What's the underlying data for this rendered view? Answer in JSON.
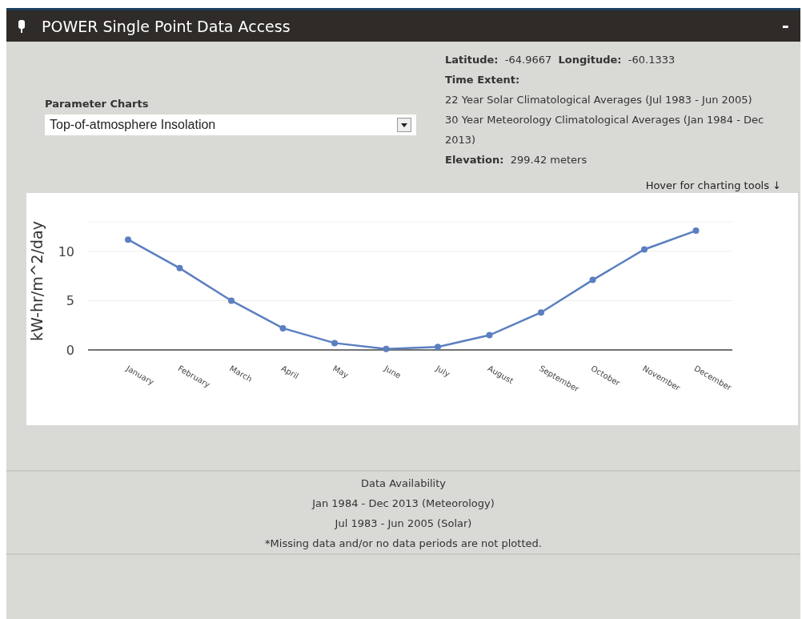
{
  "window": {
    "title": "POWER Single Point Data Access",
    "collapse": "-"
  },
  "parameter": {
    "label": "Parameter Charts",
    "value": "Top-of-atmosphere Insolation"
  },
  "info": [
    {
      "kind": "text",
      "text": "**Latitude:**  -64.9667  **Longitude:**  -60.1333"
    },
    {
      "kind": "label",
      "text": "Time Extent:"
    },
    {
      "kind": "text",
      "text": "22 Year Solar Climatological Averages (Jul 1983 - Jun 2005)"
    },
    {
      "kind": "text",
      "text": "30 Year Meteorology Climatological Averages (Jan 1984 - Dec 2013)"
    },
    {
      "kind": "text",
      "text": "**Elevation:**  299.42 meters"
    }
  ],
  "hover_hint": "Hover for charting tools ↓",
  "chart_data": {
    "type": "line",
    "ylabel": "kW-hr/m^2/day",
    "categories": [
      "January",
      "February",
      "March",
      "April",
      "May",
      "June",
      "July",
      "August",
      "September",
      "October",
      "November",
      "December"
    ],
    "series": [
      {
        "color": "#5b7fc0",
        "marker": "circle",
        "values": [
          11.2,
          8.3,
          5.0,
          2.2,
          0.7,
          0.1,
          0.3,
          1.5,
          3.8,
          7.1,
          10.2,
          12.1
        ]
      }
    ],
    "ylim": [
      0,
      13
    ],
    "yticks": [
      0,
      5,
      10
    ]
  },
  "footer": {
    "title": "Data Availability",
    "lines": [
      "Jan 1984 - Dec 2013 (Meteorology)",
      "Jul 1983 - Jun 2005 (Solar)",
      "*Missing data and/or no data periods are not plotted."
    ]
  }
}
